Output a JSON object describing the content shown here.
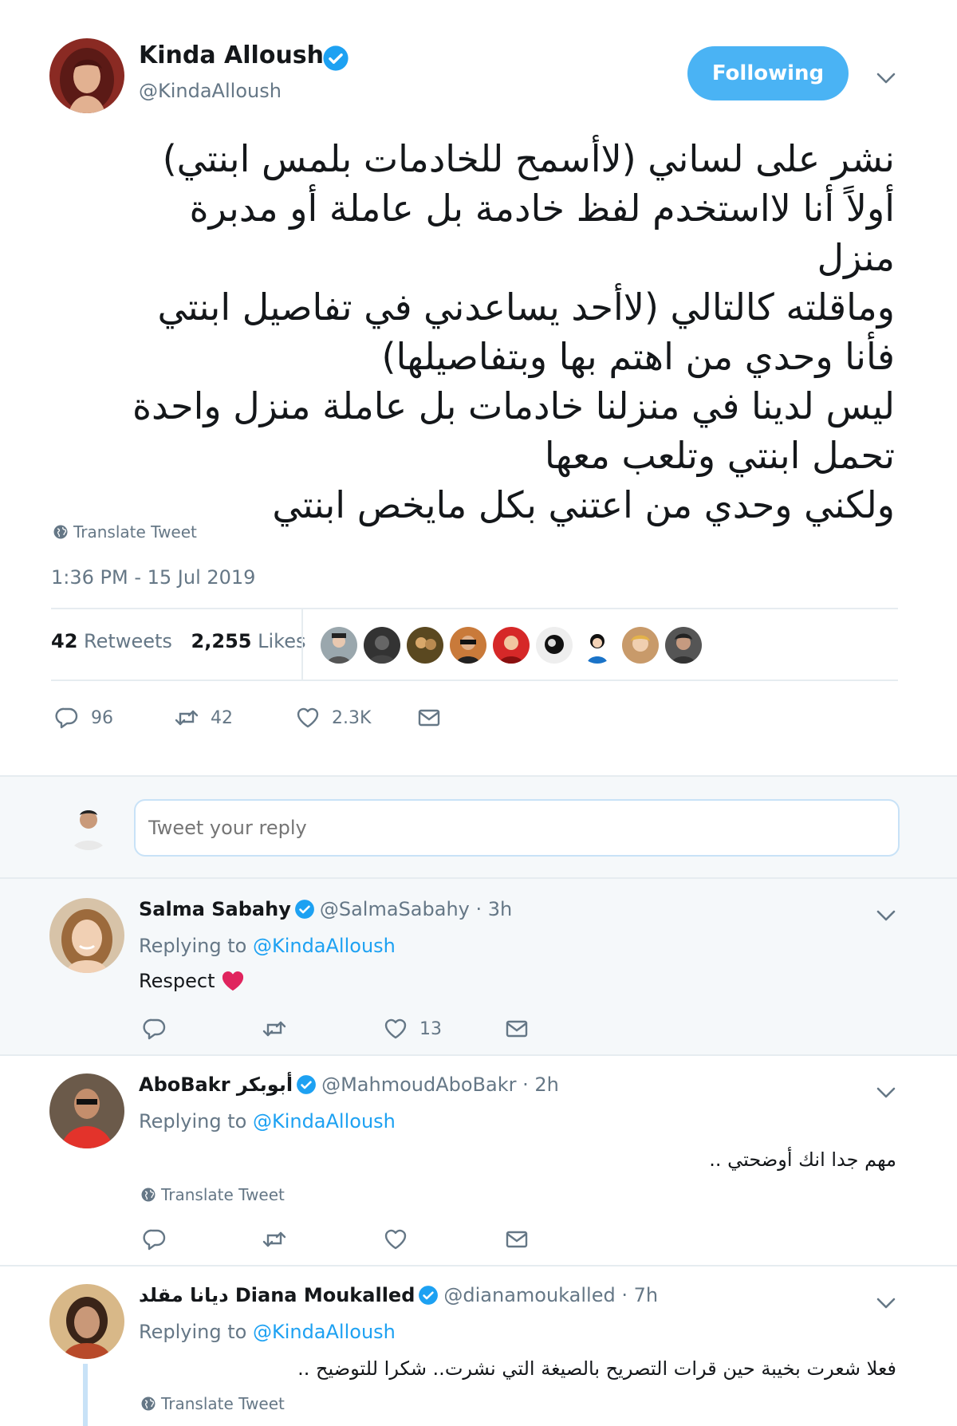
{
  "main_tweet": {
    "name": "Kinda Alloush",
    "handle": "@KindaAlloush",
    "follow_label": "Following",
    "text_lines": [
      "نشر على لساني (لاأسمح للخادمات بلمس ابنتي)",
      "أولاً أنا لااستخدم لفظ خادمة بل عاملة أو مدبرة",
      "منزل",
      "وماقلته كالتالي (لاأحد يساعدني في تفاصيل ابنتي",
      "فأنا وحدي من اهتم بها وبتفاصيلها)",
      "ليس لدينا في منزلنا خادمات بل عاملة منزل واحدة",
      "تحمل ابنتي وتلعب معها",
      "ولكني وحدي من اعتني بكل مايخص ابنتي"
    ],
    "translate_label": "Translate Tweet",
    "timestamp": "1:36 PM - 15 Jul 2019",
    "retweets_count": "42",
    "retweets_label": "Retweets",
    "likes_count": "2,255",
    "likes_label": "Likes",
    "actions": {
      "replies": "96",
      "retweets": "42",
      "likes": "2.3K"
    }
  },
  "reply_box": {
    "placeholder": "Tweet your reply"
  },
  "replies": [
    {
      "name": "Salma Sabahy",
      "handle": "@SalmaSabahy",
      "time": "· 3h",
      "replying_prefix": "Replying to",
      "replying_to": "@KindaAlloush",
      "text": "Respect",
      "likes": "13"
    },
    {
      "name": "AboBakr أبوبكر",
      "handle": "@MahmoudAboBakr",
      "time": "· 2h",
      "replying_prefix": "Replying to",
      "replying_to": "@KindaAlloush",
      "text": "مهم جدا انك أوضحتي ..",
      "translate_label": "Translate Tweet"
    },
    {
      "name": "ديانا مقلد Diana Moukalled",
      "handle": "@dianamoukalled",
      "time": "· 7h",
      "replying_prefix": "Replying to",
      "replying_to": "@KindaAlloush",
      "text": "فعلا شعرت بخيبة حين قرات التصريح بالصيغة التي نشرت.. شكرا للتوضيح ..",
      "translate_label": "Translate Tweet"
    }
  ],
  "colors": {
    "accent": "#1da1f2",
    "follow_button": "#4ab3f4",
    "heart": "#e0245e",
    "secondary_text": "#657786"
  }
}
